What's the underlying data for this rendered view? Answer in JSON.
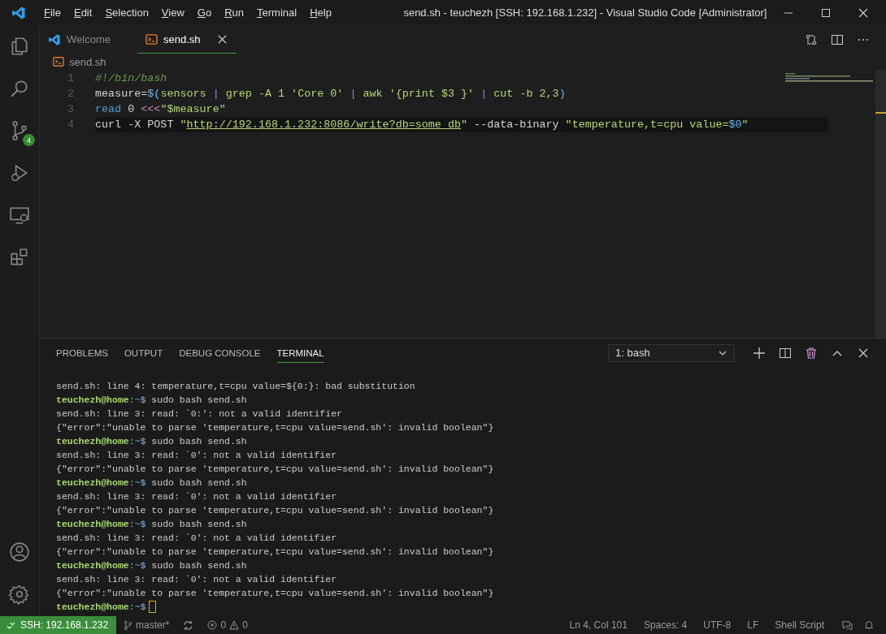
{
  "window": {
    "title": "send.sh - teuchezh [SSH: 192.168.1.232] - Visual Studio Code [Administrator]"
  },
  "menu": [
    "File",
    "Edit",
    "Selection",
    "View",
    "Go",
    "Run",
    "Terminal",
    "Help"
  ],
  "activity_bar": {
    "source_control_badge": "4"
  },
  "tabs": [
    {
      "label": "Welcome",
      "kind": "welcome",
      "selected": false
    },
    {
      "label": "send.sh",
      "kind": "shell",
      "selected": true
    }
  ],
  "breadcrumb": "send.sh",
  "code": [
    {
      "number": "1",
      "current": false,
      "tokens": [
        {
          "kind": "comment",
          "text": "#!/bin/bash"
        }
      ]
    },
    {
      "number": "2",
      "current": false,
      "tokens": [
        {
          "kind": "plain",
          "text": "measure="
        },
        {
          "kind": "variable",
          "text": "$("
        },
        {
          "kind": "string",
          "text": "sensors "
        },
        {
          "kind": "operator",
          "text": "|"
        },
        {
          "kind": "string",
          "text": " grep -A 1 'Core 0' "
        },
        {
          "kind": "operator",
          "text": "|"
        },
        {
          "kind": "string",
          "text": " awk '{print $3 }' "
        },
        {
          "kind": "operator",
          "text": "|"
        },
        {
          "kind": "string",
          "text": " cut -b 2,3"
        },
        {
          "kind": "variable",
          "text": ")"
        }
      ]
    },
    {
      "number": "3",
      "current": false,
      "tokens": [
        {
          "kind": "keyword",
          "text": "read"
        },
        {
          "kind": "plain",
          "text": " 0 "
        },
        {
          "kind": "redirect",
          "text": "<<<"
        },
        {
          "kind": "string",
          "text": "\"$measure\""
        }
      ]
    },
    {
      "number": "4",
      "current": true,
      "tokens": [
        {
          "kind": "plain",
          "text": "curl -X POST "
        },
        {
          "kind": "string",
          "text": "\""
        },
        {
          "kind": "url",
          "text": "http://192.168.1.232:8086/write?db=some_db"
        },
        {
          "kind": "string",
          "text": "\""
        },
        {
          "kind": "plain",
          "text": " --data-binary "
        },
        {
          "kind": "string",
          "text": "\"temperature,t=cpu value="
        },
        {
          "kind": "variable",
          "text": "$0"
        },
        {
          "kind": "string",
          "text": "\""
        }
      ]
    }
  ],
  "panel": {
    "tabs": [
      {
        "label": "PROBLEMS",
        "selected": false
      },
      {
        "label": "OUTPUT",
        "selected": false
      },
      {
        "label": "DEBUG CONSOLE",
        "selected": false
      },
      {
        "label": "TERMINAL",
        "selected": true
      }
    ],
    "terminal_select": "1: bash",
    "terminal": [
      {
        "kind": "output",
        "text": "send.sh: line 4: temperature,t=cpu value=${0:}: bad substitution"
      },
      {
        "kind": "prompt",
        "user": "teuchezh@home",
        "path": ":~$",
        "command": "sudo bash send.sh"
      },
      {
        "kind": "output",
        "text": "send.sh: line 3: read: `0:': not a valid identifier"
      },
      {
        "kind": "output",
        "text": "{\"error\":\"unable to parse 'temperature,t=cpu value=send.sh': invalid boolean\"}"
      },
      {
        "kind": "prompt",
        "user": "teuchezh@home",
        "path": ":~$",
        "command": "sudo bash send.sh"
      },
      {
        "kind": "output",
        "text": "send.sh: line 3: read: `0': not a valid identifier"
      },
      {
        "kind": "output",
        "text": "{\"error\":\"unable to parse 'temperature,t=cpu value=send.sh': invalid boolean\"}"
      },
      {
        "kind": "prompt",
        "user": "teuchezh@home",
        "path": ":~$",
        "command": "sudo bash send.sh"
      },
      {
        "kind": "output",
        "text": "send.sh: line 3: read: `0': not a valid identifier"
      },
      {
        "kind": "output",
        "text": "{\"error\":\"unable to parse 'temperature,t=cpu value=send.sh': invalid boolean\"}"
      },
      {
        "kind": "prompt",
        "user": "teuchezh@home",
        "path": ":~$",
        "command": "sudo bash send.sh"
      },
      {
        "kind": "output",
        "text": "send.sh: line 3: read: `0': not a valid identifier"
      },
      {
        "kind": "output",
        "text": "{\"error\":\"unable to parse 'temperature,t=cpu value=send.sh': invalid boolean\"}"
      },
      {
        "kind": "prompt",
        "user": "teuchezh@home",
        "path": ":~$",
        "command": "sudo bash send.sh"
      },
      {
        "kind": "output",
        "text": "send.sh: line 3: read: `0': not a valid identifier"
      },
      {
        "kind": "output",
        "text": "{\"error\":\"unable to parse 'temperature,t=cpu value=send.sh': invalid boolean\"}"
      },
      {
        "kind": "prompt",
        "user": "teuchezh@home",
        "path": ":~$",
        "cursor": true
      }
    ]
  },
  "status_bar": {
    "remote": "SSH: 192.168.1.232",
    "branch": "master*",
    "errors": "0",
    "warnings": "0",
    "right": [
      "Ln 4, Col 101",
      "Spaces: 4",
      "UTF-8",
      "LF",
      "Shell Script"
    ]
  }
}
